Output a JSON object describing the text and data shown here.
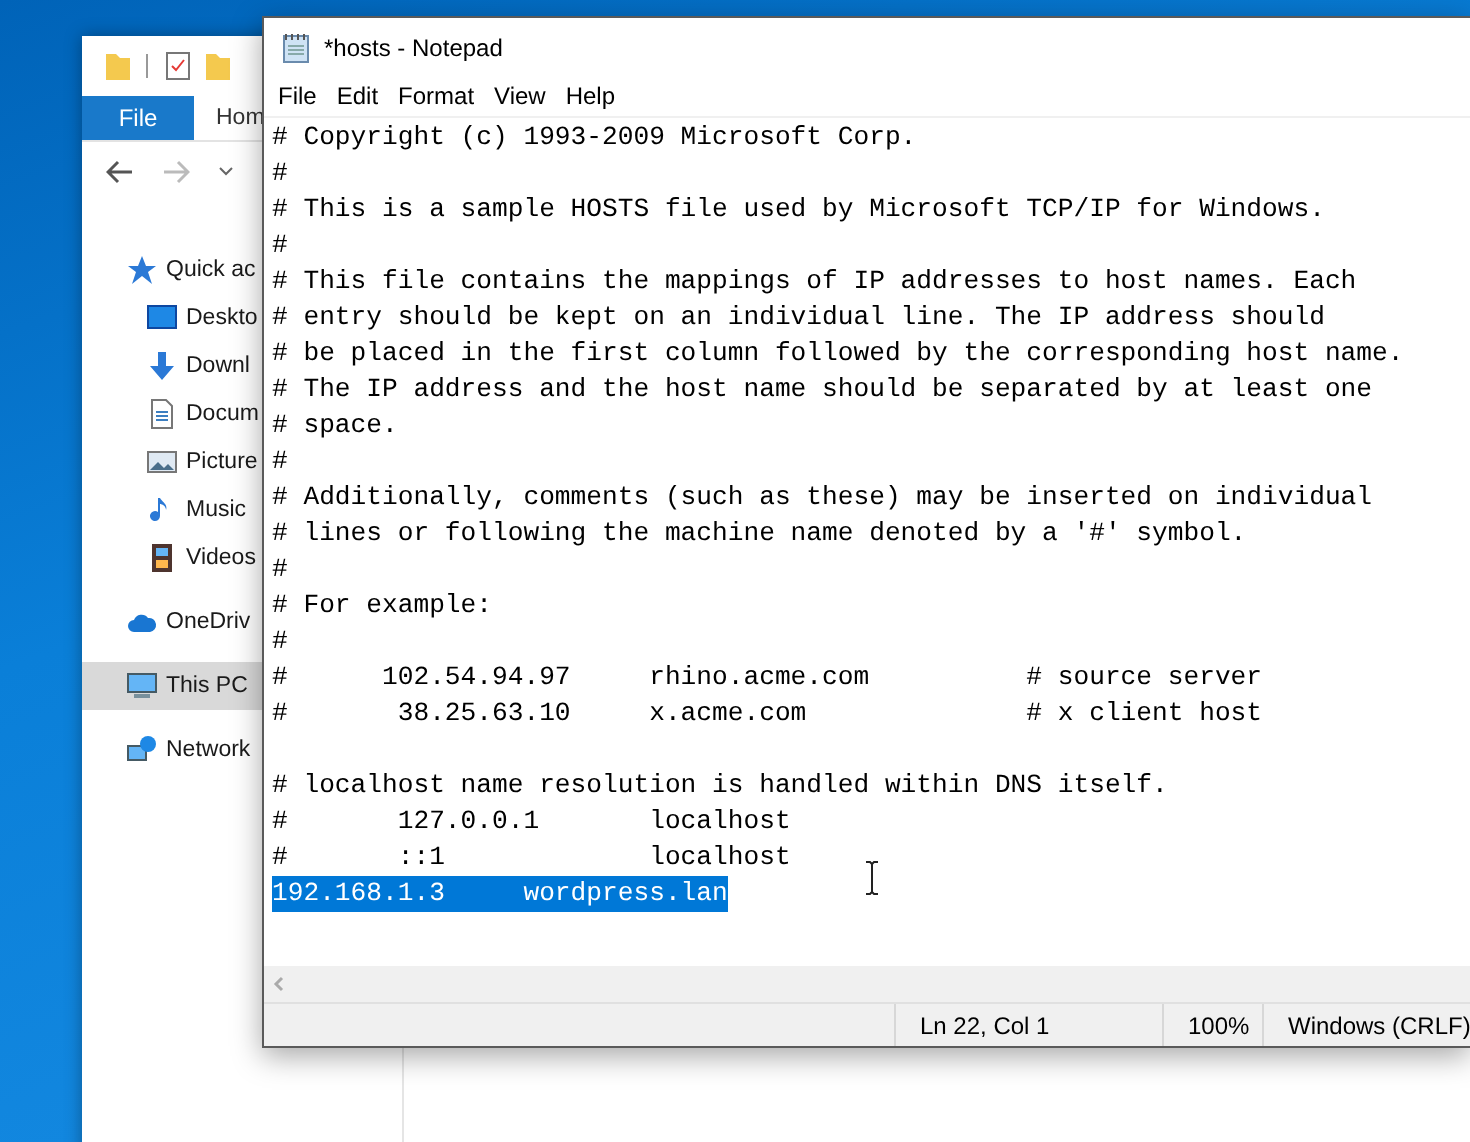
{
  "explorer": {
    "ribbon_tabs": [
      {
        "label": "File",
        "selected": true
      },
      {
        "label": "Hom",
        "selected": false
      }
    ],
    "sidebar": {
      "items": [
        {
          "label": "Quick ac",
          "kind": "star",
          "selected": false,
          "children": [
            {
              "label": "Deskto",
              "kind": "desktop",
              "selected": false
            },
            {
              "label": "Downl",
              "kind": "download",
              "selected": false
            },
            {
              "label": "Docum",
              "kind": "document",
              "selected": false
            },
            {
              "label": "Picture",
              "kind": "picture",
              "selected": false
            },
            {
              "label": "Music",
              "kind": "music",
              "selected": false
            },
            {
              "label": "Videos",
              "kind": "video",
              "selected": false
            }
          ]
        },
        {
          "label": "OneDriv",
          "kind": "cloud",
          "selected": false
        },
        {
          "label": "This PC",
          "kind": "pc",
          "selected": true
        },
        {
          "label": "Network",
          "kind": "network",
          "selected": false
        }
      ]
    }
  },
  "notepad": {
    "window": {
      "title": "*hosts - Notepad"
    },
    "menu": [
      "File",
      "Edit",
      "Format",
      "View",
      "Help"
    ],
    "lines": [
      {
        "kind": "text",
        "text": "# Copyright (c) 1993-2009 Microsoft Corp.",
        "selected": false
      },
      {
        "kind": "text",
        "text": "#",
        "selected": false
      },
      {
        "kind": "text",
        "text": "# This is a sample HOSTS file used by Microsoft TCP/IP for Windows.",
        "selected": false
      },
      {
        "kind": "text",
        "text": "#",
        "selected": false
      },
      {
        "kind": "text",
        "text": "# This file contains the mappings of IP addresses to host names. Each",
        "selected": false
      },
      {
        "kind": "text",
        "text": "# entry should be kept on an individual line. The IP address should",
        "selected": false
      },
      {
        "kind": "text",
        "text": "# be placed in the first column followed by the corresponding host name.",
        "selected": false
      },
      {
        "kind": "text",
        "text": "# The IP address and the host name should be separated by at least one",
        "selected": false
      },
      {
        "kind": "text",
        "text": "# space.",
        "selected": false
      },
      {
        "kind": "text",
        "text": "#",
        "selected": false
      },
      {
        "kind": "text",
        "text": "# Additionally, comments (such as these) may be inserted on individual",
        "selected": false
      },
      {
        "kind": "text",
        "text": "# lines or following the machine name denoted by a '#' symbol.",
        "selected": false
      },
      {
        "kind": "text",
        "text": "#",
        "selected": false
      },
      {
        "kind": "text",
        "text": "# For example:",
        "selected": false
      },
      {
        "kind": "text",
        "text": "#",
        "selected": false
      },
      {
        "kind": "text",
        "text": "#      102.54.94.97     rhino.acme.com          # source server",
        "selected": false
      },
      {
        "kind": "text",
        "text": "#       38.25.63.10     x.acme.com              # x client host",
        "selected": false
      },
      {
        "kind": "blank"
      },
      {
        "kind": "text",
        "text": "# localhost name resolution is handled within DNS itself.",
        "selected": false
      },
      {
        "kind": "text",
        "text": "#       127.0.0.1       localhost",
        "selected": false
      },
      {
        "kind": "text",
        "text": "#       ::1             localhost",
        "selected": false
      },
      {
        "kind": "text",
        "text": "192.168.1.3     wordpress.lan",
        "selected": true
      }
    ],
    "status_bar": {
      "position": "Ln 22, Col 1",
      "zoom": "100%",
      "line_ending": "Windows (CRLF)"
    }
  }
}
